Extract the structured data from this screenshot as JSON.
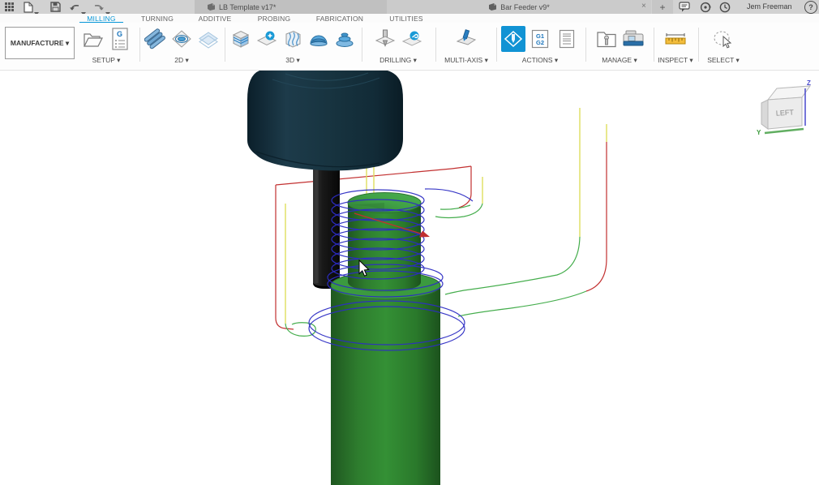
{
  "titlebar": {
    "tabs": [
      {
        "label": "LB Template v17*",
        "close": "×"
      },
      {
        "label": "Bar Feeder v9*",
        "close": "×"
      }
    ],
    "new_tab_label": "+",
    "username": "Jem Freeman",
    "help_label": "?"
  },
  "ribbon": {
    "tabs": [
      "MILLING",
      "TURNING",
      "ADDITIVE",
      "PROBING",
      "FABRICATION",
      "UTILITIES"
    ],
    "active_tab": "MILLING"
  },
  "toolbar": {
    "workspace_label": "MANUFACTURE ▾",
    "groups": [
      {
        "label": "SETUP ▾"
      },
      {
        "label": "2D ▾"
      },
      {
        "label": "3D ▾"
      },
      {
        "label": "DRILLING ▾"
      },
      {
        "label": "MULTI-AXIS ▾"
      },
      {
        "label": "ACTIONS ▾"
      },
      {
        "label": "MANAGE ▾"
      },
      {
        "label": "INSPECT ▾"
      },
      {
        "label": "SELECT ▾"
      }
    ],
    "nc_icon_letter": "G",
    "post_icon_lines": [
      "G1",
      "G2"
    ]
  },
  "viewcube": {
    "face": "LEFT",
    "axis_z": "Z",
    "axis_y": "Y"
  },
  "scene_colors": {
    "accent_blue": "#0696d7",
    "part_green": "#2f8433",
    "holder_navy": "#14303e",
    "tool_black": "#161616",
    "toolpath_cutting_blue": "#2d2dc4",
    "toolpath_rapid_red": "#c23030",
    "toolpath_lead_yellow": "#dede5e",
    "toolpath_lead_green": "#44ad4c"
  }
}
